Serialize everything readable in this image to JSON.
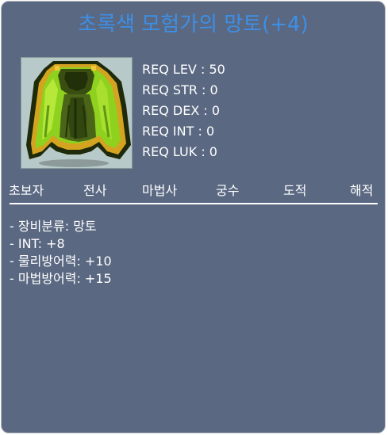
{
  "item": {
    "name": "초록색 모험가의 망토(+4)",
    "icon": "green-cape-icon"
  },
  "requirements": [
    {
      "label": "REQ LEV",
      "value": "50"
    },
    {
      "label": "REQ STR",
      "value": "0"
    },
    {
      "label": "REQ DEX",
      "value": "0"
    },
    {
      "label": "REQ INT",
      "value": "0"
    },
    {
      "label": "REQ LUK",
      "value": "0"
    }
  ],
  "jobs": [
    "초보자",
    "전사",
    "마법사",
    "궁수",
    "도적",
    "해적"
  ],
  "stats": [
    "- 장비분류: 망토",
    "- INT: +8",
    "- 물리방어력: +10",
    "- 마법방어력: +15"
  ],
  "colors": {
    "background": "#5a6882",
    "title": "#3d8fe6",
    "text": "#ffffff",
    "icon_bg": "#b7c9c9"
  }
}
